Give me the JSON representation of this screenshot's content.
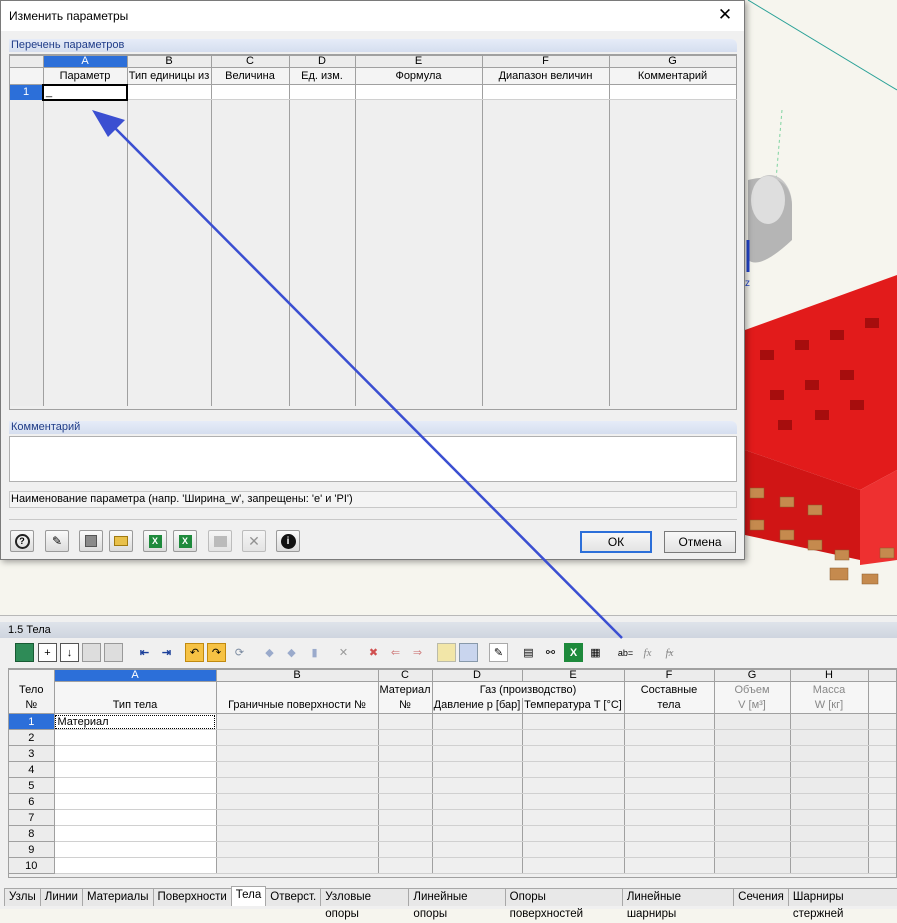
{
  "dialog": {
    "title": "Изменить параметры",
    "params_section": "Перечень параметров",
    "columns": [
      {
        "letter": "A",
        "label": "Параметр"
      },
      {
        "letter": "B",
        "label": "Тип единицы из"
      },
      {
        "letter": "C",
        "label": "Величина"
      },
      {
        "letter": "D",
        "label": "Ед. изм."
      },
      {
        "letter": "E",
        "label": "Формула"
      },
      {
        "letter": "F",
        "label": "Диапазон величин"
      },
      {
        "letter": "G",
        "label": "Комментарий"
      }
    ],
    "row_number": "1",
    "comment_section": "Комментарий",
    "hint": "Наименование параметра (напр. 'Ширина_w', запрещены: 'e' и 'PI')",
    "ok": "ОК",
    "cancel": "Отмена",
    "icons": [
      "help-icon",
      "edit-icon",
      "save-icon",
      "open-folder-icon",
      "import-excel-icon",
      "export-excel-icon",
      "calculator-icon",
      "delete-icon",
      "info-icon"
    ]
  },
  "panel": {
    "title": "1.5 Тела",
    "header": {
      "body_no_line1": "Тело",
      "body_no_line2": "№",
      "letters": [
        "A",
        "B",
        "C",
        "D",
        "E",
        "F",
        "G",
        "H"
      ],
      "a_label": "Тип тела",
      "b_label": "Граничные поверхности №",
      "c_line1": "Материал",
      "c_line2": "№",
      "de_group": "Газ (производство)",
      "d_label": "Давление p [бар]",
      "e_label": "Температура T  [°C]",
      "f_line1": "Составные",
      "f_line2": "тела",
      "g_line1": "Объем",
      "g_line2": "V [м³]",
      "h_line1": "Масса",
      "h_line2": "W [кг]"
    },
    "rows": [
      "1",
      "2",
      "3",
      "4",
      "5",
      "6",
      "7",
      "8",
      "9",
      "10"
    ],
    "row1_type": "Материал",
    "tabs": [
      "Узлы",
      "Линии",
      "Материалы",
      "Поверхности",
      "Тела",
      "Отверст.",
      "Узловые опоры",
      "Линейные опоры",
      "Опоры поверхностей",
      "Линейные шарниры",
      "Сечения",
      "Шарниры стержней"
    ],
    "active_tab": "Тела",
    "colors": {
      "selection": "#2c6fd9",
      "arrow": "#3b4fd1",
      "solid": "#e21b1b"
    }
  }
}
